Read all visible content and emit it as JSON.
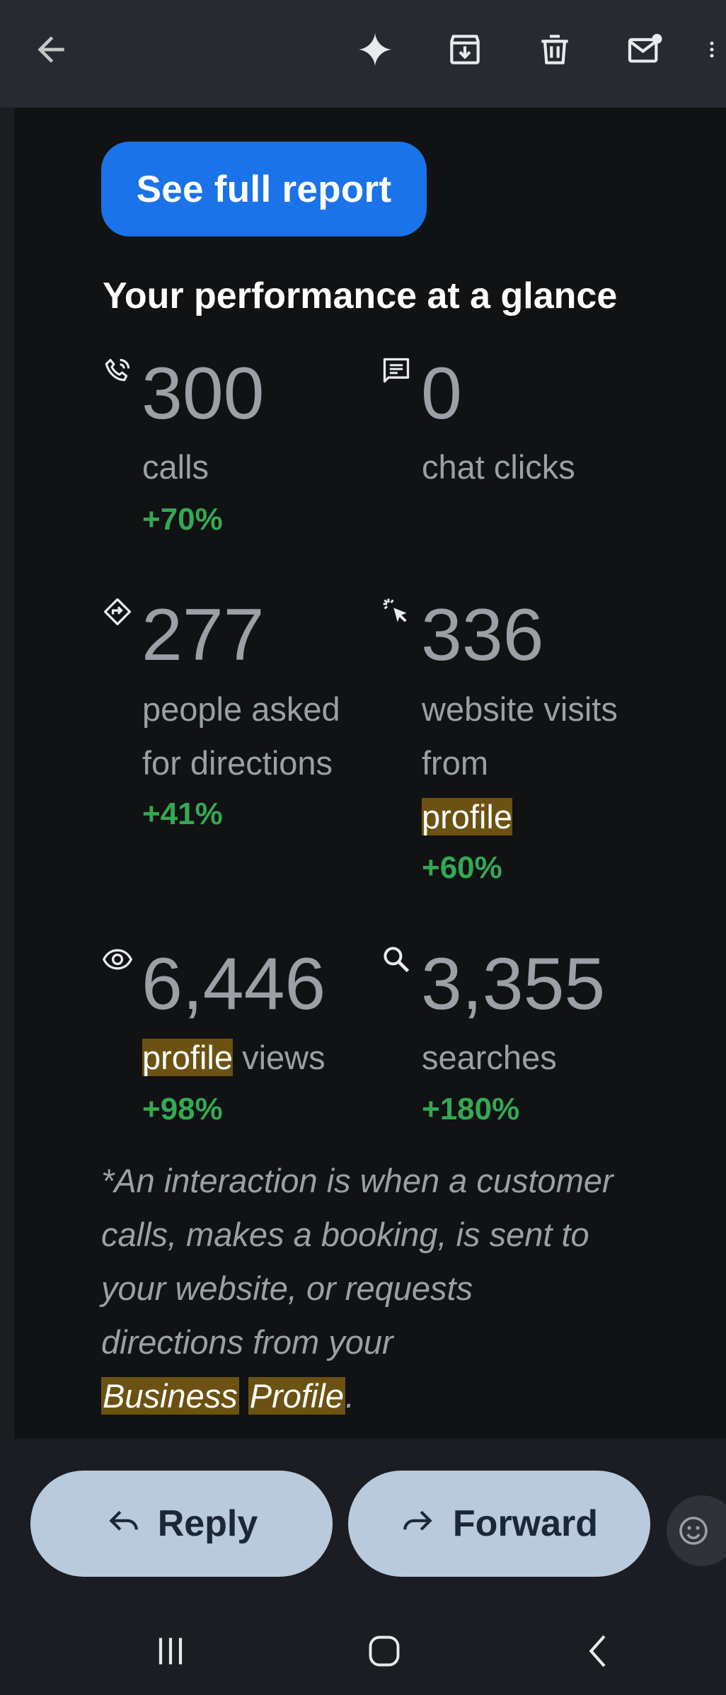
{
  "toolbar": {
    "back_icon": "arrow-back-icon",
    "icons": [
      "gemini-sparkle-icon",
      "archive-icon",
      "trash-icon",
      "mark-unread-icon",
      "more-vert-icon"
    ]
  },
  "email": {
    "report_button": "See full report",
    "heading": "Your performance at a glance",
    "metrics": [
      {
        "icon": "phone-call-icon",
        "value": "300",
        "label_lines": [
          "calls"
        ],
        "change": "+70%"
      },
      {
        "icon": "chat-icon",
        "value": "0",
        "label_lines": [
          "chat clicks"
        ],
        "change": ""
      },
      {
        "icon": "directions-icon",
        "value": "277",
        "label_lines": [
          "people asked",
          "for directions"
        ],
        "change": "+41%"
      },
      {
        "icon": "click-cursor-icon",
        "value": "336",
        "label_lines": [
          "website visits",
          "from"
        ],
        "label_highlight": "profile",
        "change": "+60%"
      },
      {
        "icon": "eye-icon",
        "value": "6,446",
        "label_highlight": "profile",
        "label_rest": " views",
        "change": "+98%"
      },
      {
        "icon": "search-icon",
        "value": "3,355",
        "label_lines": [
          "searches"
        ],
        "change": "+180%"
      }
    ],
    "footnote_lines": [
      "*An interaction is when a customer",
      "calls, makes a booking, is sent to",
      "your website, or requests",
      "directions from your"
    ],
    "footnote_hl1": "Business",
    "footnote_hl2": "Profile",
    "footnote_end": "."
  },
  "actions": {
    "reply_label": "Reply",
    "forward_label": "Forward"
  },
  "colors": {
    "accent": "#1a73e8",
    "positive": "#34a853",
    "highlight": "#6b5212",
    "pill": "#b8cadb"
  }
}
